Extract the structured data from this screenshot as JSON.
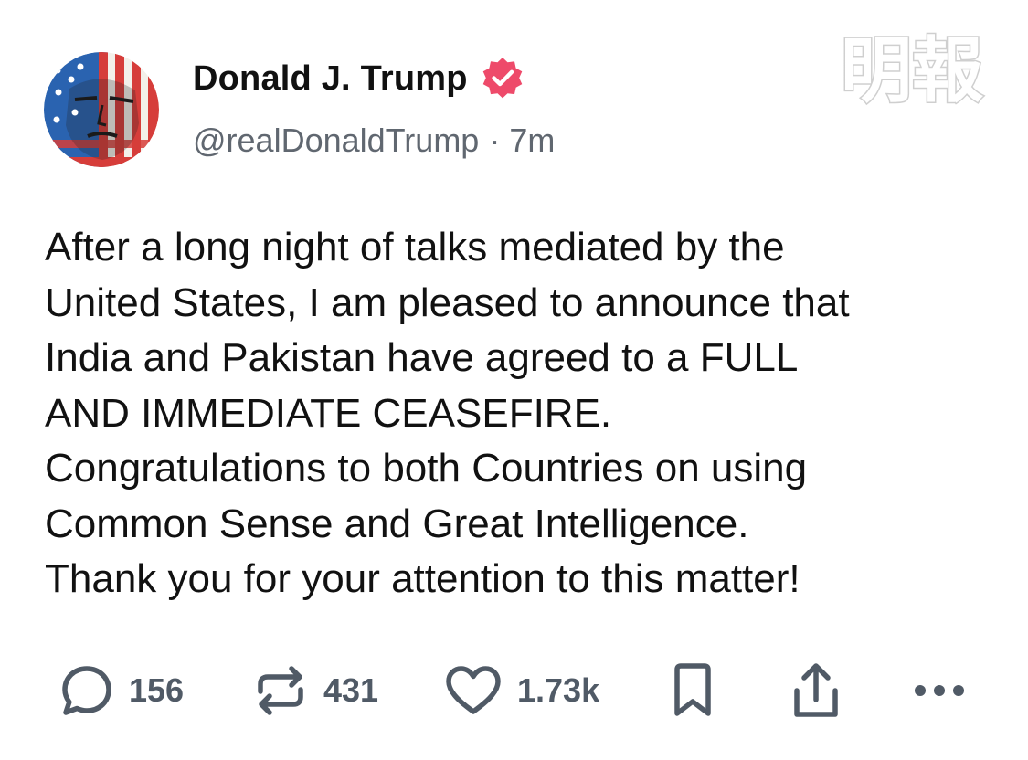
{
  "post": {
    "author": {
      "display_name": "Donald J. Trump",
      "handle": "@realDonaldTrump",
      "verified_icon": "verified-badge-icon",
      "avatar_icon": "avatar"
    },
    "separator": "·",
    "time_ago": "7m",
    "body_lines": [
      "After a long night of talks mediated by the",
      "United States, I am pleased to announce that",
      "India and Pakistan have agreed to a FULL",
      "AND IMMEDIATE CEASEFIRE.",
      "Congratulations to both Countries on using",
      "Common Sense and Great Intelligence.",
      "Thank you for your attention to this matter!"
    ],
    "actions": {
      "replies": {
        "icon": "reply-icon",
        "count": "156"
      },
      "reposts": {
        "icon": "repost-icon",
        "count": "431"
      },
      "likes": {
        "icon": "heart-icon",
        "count": "1.73k"
      },
      "bookmark": {
        "icon": "bookmark-icon"
      },
      "share": {
        "icon": "share-icon"
      },
      "more": {
        "icon": "more-icon"
      }
    }
  },
  "watermark": {
    "text": "明報"
  },
  "colors": {
    "text": "#111111",
    "secondary": "#606770",
    "action_gray": "#505a66",
    "verified": "#ee4a6a",
    "watermark": "#d4d4d4"
  }
}
